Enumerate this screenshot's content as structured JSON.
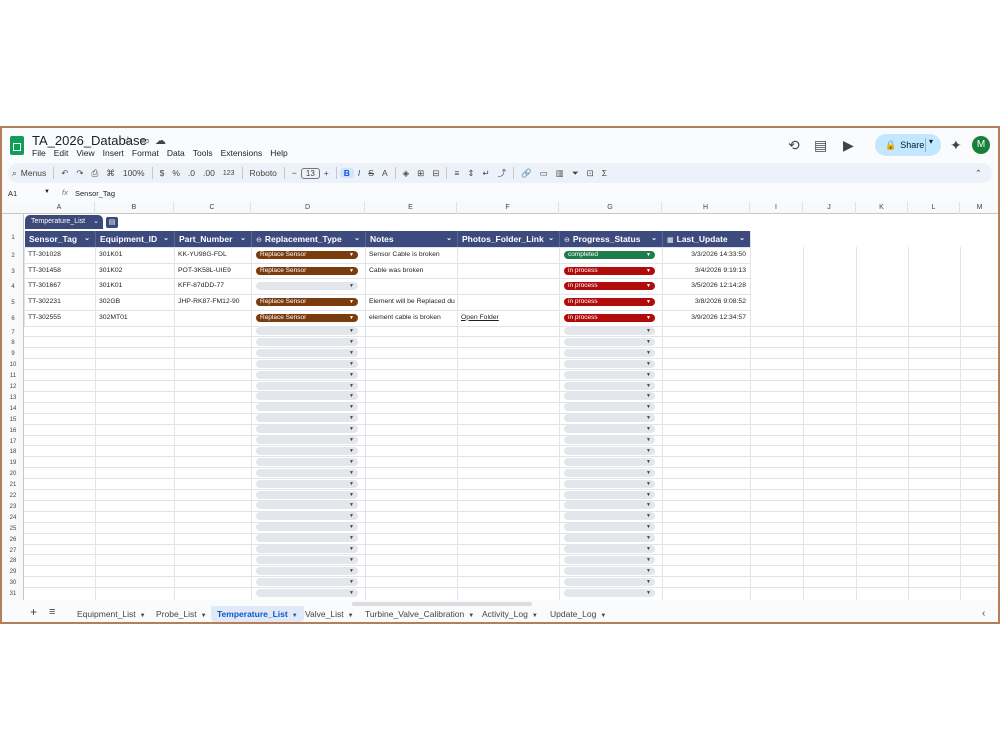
{
  "app": {
    "doc_title": "TA_2026_Database",
    "menus": [
      "File",
      "Edit",
      "View",
      "Insert",
      "Format",
      "Data",
      "Tools",
      "Extensions",
      "Help"
    ],
    "share_label": "Share",
    "avatar_letter": "M"
  },
  "toolbar": {
    "menus_label": "Menus",
    "zoom": "100%",
    "currency": "$",
    "percent": "%",
    "dec_decrease": ".0",
    "dec_increase": ".00",
    "number_format": "123",
    "font": "Roboto",
    "font_size": "13",
    "bold": "B",
    "italic": "I",
    "strike": "S",
    "text_color": "A",
    "functions": "Σ"
  },
  "formula_bar": {
    "cell_ref": "A1",
    "fx": "fx",
    "value": "Sensor_Tag"
  },
  "grid": {
    "column_letters": [
      "A",
      "B",
      "C",
      "D",
      "E",
      "F",
      "G",
      "H",
      "I",
      "J",
      "K",
      "L",
      "M"
    ],
    "row_numbers": [
      "1",
      "2",
      "3",
      "4",
      "5",
      "6",
      "7",
      "8",
      "9",
      "10",
      "11",
      "12",
      "13",
      "14",
      "15",
      "16",
      "17",
      "18",
      "19",
      "20",
      "21",
      "22",
      "23",
      "24",
      "25",
      "26",
      "27",
      "28",
      "29",
      "30",
      "31"
    ],
    "table_name": "Temperature_List",
    "headers": [
      "Sensor_Tag",
      "Equipment_ID",
      "Part_Number",
      "Replacement_Type",
      "Notes",
      "Photos_Folder_Link",
      "Progress_Status",
      "Last_Update"
    ],
    "rows": [
      {
        "sensor_tag": "TT-301028",
        "equipment_id": "301K01",
        "part_number": "KK-YU98G-FDL",
        "replacement_type": "Replace Sensor",
        "notes": "Sensor Cable is broken",
        "photos_link": "",
        "status": "completed",
        "last_update": "3/3/2026 14:33:50"
      },
      {
        "sensor_tag": "TT-301458",
        "equipment_id": "301K02",
        "part_number": "POT-3K58L-UIE9",
        "replacement_type": "Replace Sensor",
        "notes": "Cable was broken",
        "photos_link": "",
        "status": "in process",
        "last_update": "3/4/2026 9:19:13"
      },
      {
        "sensor_tag": "TT-301667",
        "equipment_id": "301K01",
        "part_number": "KFF-87dDD-77",
        "replacement_type": "",
        "notes": "",
        "photos_link": "",
        "status": "in process",
        "last_update": "3/5/2026 12:14:28"
      },
      {
        "sensor_tag": "TT-302231",
        "equipment_id": "302GB",
        "part_number": "JHP-RK87-FM12-90",
        "replacement_type": "Replace Sensor",
        "notes": "Element will be Replaced du",
        "photos_link": "",
        "status": "in process",
        "last_update": "3/8/2026 9:08:52"
      },
      {
        "sensor_tag": "TT-302555",
        "equipment_id": "302MT01",
        "part_number": "",
        "replacement_type": "Replace Sensor",
        "notes": "element cable is broken",
        "photos_link": "Open Folder",
        "status": "in process",
        "last_update": "3/9/2026 12:34:57"
      }
    ]
  },
  "colors": {
    "header_bg": "#3c4a7e",
    "replace_chip": "#7a3b0f",
    "completed_chip": "#1e7d4c",
    "in_process_chip": "#b10c0c"
  },
  "sheets": {
    "tabs": [
      {
        "label": "Equipment_List",
        "active": false
      },
      {
        "label": "Probe_List",
        "active": false
      },
      {
        "label": "Temperature_List",
        "active": true
      },
      {
        "label": "Valve_List",
        "active": false
      },
      {
        "label": "Turbine_Valve_Calibration",
        "active": false
      },
      {
        "label": "Activity_Log",
        "active": false
      },
      {
        "label": "Update_Log",
        "active": false
      }
    ]
  }
}
